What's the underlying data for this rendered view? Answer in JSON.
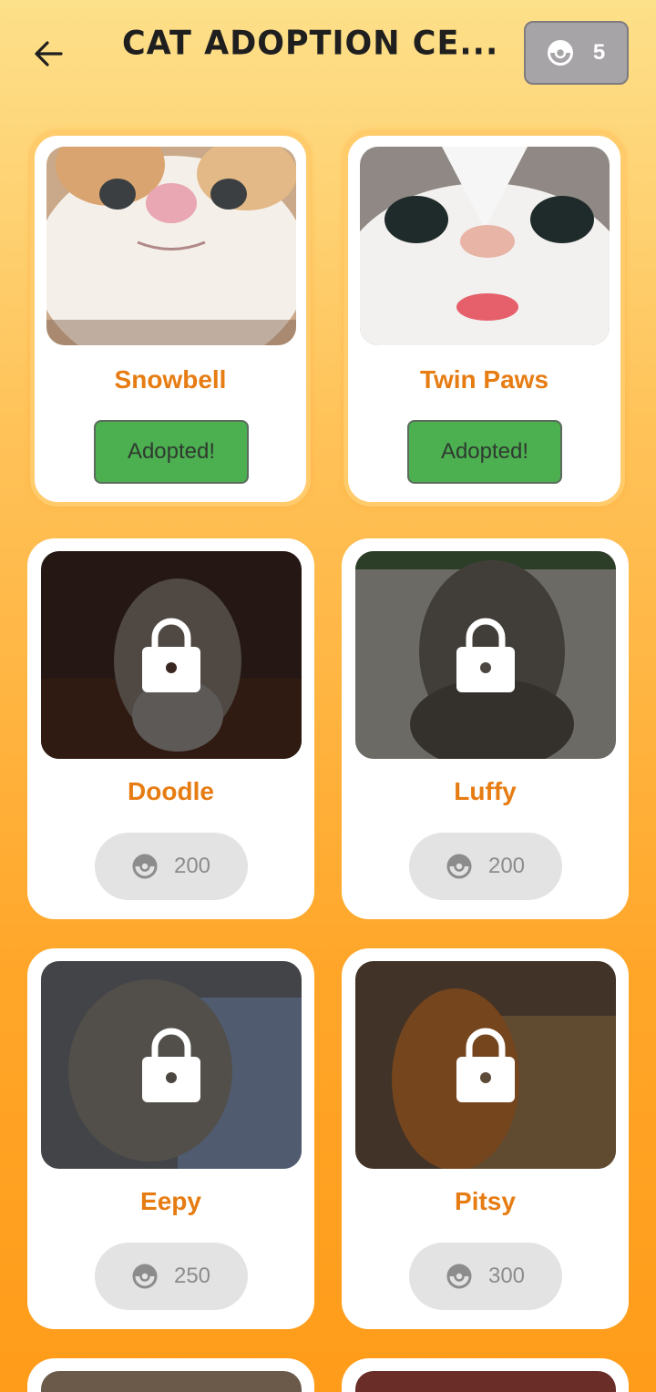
{
  "header": {
    "title": "Cat Adoption Ce...",
    "back_icon": "arrow-left-icon",
    "coin_icon": "pokeball-icon",
    "coin_count": "5"
  },
  "colors": {
    "accent_orange": "#e67c12",
    "adopted_green": "#4caf50",
    "badge_gray": "#a7a4a8"
  },
  "cats": [
    {
      "name": "Snowbell",
      "status": "adopted",
      "button_label": "Adopted!"
    },
    {
      "name": "Twin Paws",
      "status": "adopted",
      "button_label": "Adopted!"
    },
    {
      "name": "Doodle",
      "status": "locked",
      "price": "200",
      "lock_icon": "lock-icon",
      "price_icon": "pokeball-icon"
    },
    {
      "name": "Luffy",
      "status": "locked",
      "price": "200",
      "lock_icon": "lock-icon",
      "price_icon": "pokeball-icon"
    },
    {
      "name": "Eepy",
      "status": "locked",
      "price": "250",
      "lock_icon": "lock-icon",
      "price_icon": "pokeball-icon"
    },
    {
      "name": "Pitsy",
      "status": "locked",
      "price": "300",
      "lock_icon": "lock-icon",
      "price_icon": "pokeball-icon"
    }
  ]
}
